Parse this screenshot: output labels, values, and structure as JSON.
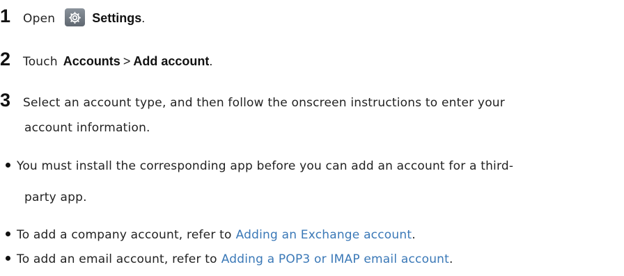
{
  "step1": {
    "number": "1",
    "prefix": "Open",
    "icon": "settings-gear-icon",
    "target": "Settings",
    "suffix": "."
  },
  "step2": {
    "number": "2",
    "prefix": "Touch",
    "item1": "Accounts",
    "separator": ">",
    "item2": "Add account",
    "suffix": "."
  },
  "step3": {
    "number": "3",
    "line1": "Select an account type, and then follow the onscreen instructions to enter your",
    "line2": "account information."
  },
  "notes": {
    "note1": {
      "line1": "You must install the corresponding app before you can add an account for a third-",
      "line2": "party app."
    },
    "note2": {
      "text": "To add a company account, refer to",
      "link": "Adding an Exchange account",
      "suffix": "."
    },
    "note3": {
      "text": "To add an email account, refer to",
      "link": "Adding a POP3 or IMAP email account",
      "suffix": "."
    }
  },
  "colors": {
    "link": "#3a78b7",
    "text": "#222222",
    "icon_bg": "#707880"
  }
}
